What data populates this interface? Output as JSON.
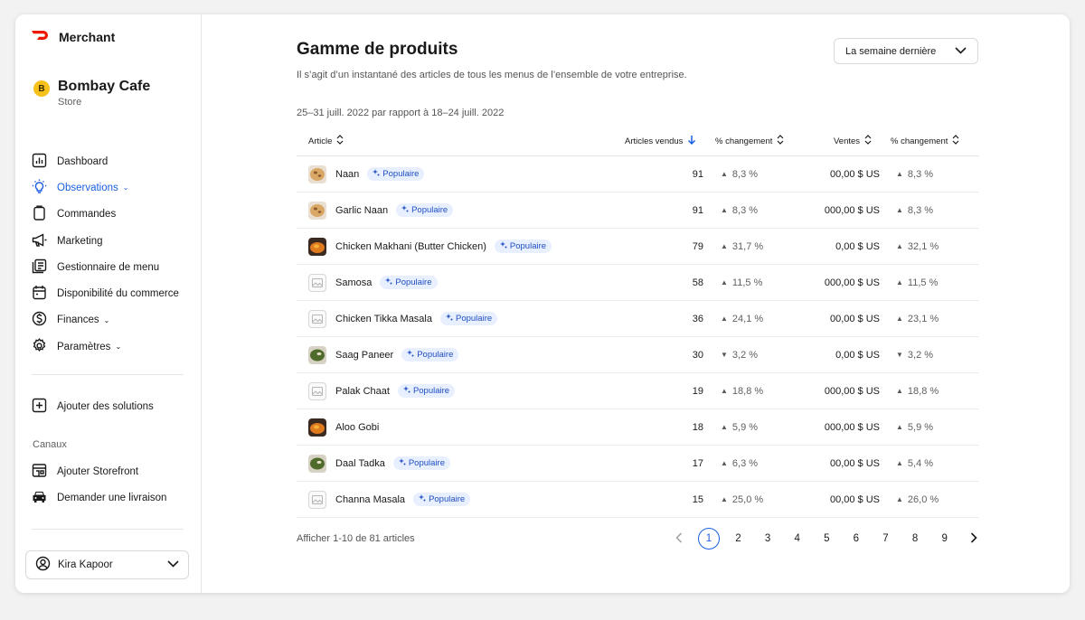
{
  "app": {
    "brand": "Merchant",
    "brand_color": "#eb1700",
    "accent": "#1a5fe0"
  },
  "store": {
    "initial": "B",
    "name": "Bombay Cafe",
    "type": "Store"
  },
  "sidebar": {
    "items": [
      {
        "label": "Dashboard",
        "icon": "chart-icon"
      },
      {
        "label": "Observations",
        "icon": "lightbulb-icon",
        "active": true,
        "caret": "⌄"
      },
      {
        "label": "Commandes",
        "icon": "clipboard-icon"
      },
      {
        "label": "Marketing",
        "icon": "megaphone-icon"
      },
      {
        "label": "Gestionnaire de menu",
        "icon": "menu-book-icon"
      },
      {
        "label": "Disponibilité du commerce",
        "icon": "calendar-icon"
      },
      {
        "label": "Finances",
        "icon": "dollar-icon",
        "caret": "⌄"
      },
      {
        "label": "Paramètres",
        "icon": "gear-icon",
        "caret": "⌄"
      }
    ],
    "add_solutions": "Ajouter des solutions",
    "channels_label": "Canaux",
    "channels": [
      {
        "label": "Ajouter Storefront",
        "icon": "storefront-icon"
      },
      {
        "label": "Demander une livraison",
        "icon": "car-icon"
      }
    ],
    "user": "Kira Kapoor"
  },
  "main": {
    "title": "Gamme de produits",
    "subtitle": "Il s’agit d’un instantané des articles de tous les menus de l’ensemble de votre entreprise.",
    "period": "La semaine dernière",
    "date_range": "25–31 juill. 2022 par rapport à 18–24 juill. 2022",
    "columns": {
      "article": "Article",
      "sold": "Articles vendus",
      "change1": "% changement",
      "sales": "Ventes",
      "change2": "% changement"
    },
    "badge_label": "Populaire",
    "rows": [
      {
        "name": "Naan",
        "popular": true,
        "thumb": "bread",
        "sold": "91",
        "change1": "8,3 %",
        "dir1": "up",
        "sales": "00,00 $ US",
        "change2": "8,3 %",
        "dir2": "up"
      },
      {
        "name": "Garlic Naan",
        "popular": true,
        "thumb": "bread",
        "sold": "91",
        "change1": "8,3 %",
        "dir1": "up",
        "sales": "000,00 $ US",
        "change2": "8,3 %",
        "dir2": "up"
      },
      {
        "name": "Chicken Makhani (Butter Chicken)",
        "popular": true,
        "thumb": "curry",
        "sold": "79",
        "change1": "31,7 %",
        "dir1": "up",
        "sales": "0,00 $ US",
        "change2": "32,1 %",
        "dir2": "up"
      },
      {
        "name": "Samosa",
        "popular": true,
        "thumb": "placeholder",
        "sold": "58",
        "change1": "11,5 %",
        "dir1": "up",
        "sales": "000,00 $ US",
        "change2": "11,5 %",
        "dir2": "up"
      },
      {
        "name": "Chicken Tikka Masala",
        "popular": true,
        "thumb": "placeholder",
        "sold": "36",
        "change1": "24,1 %",
        "dir1": "up",
        "sales": "00,00 $ US",
        "change2": "23,1 %",
        "dir2": "up"
      },
      {
        "name": "Saag Paneer",
        "popular": true,
        "thumb": "greens",
        "sold": "30",
        "change1": "3,2 %",
        "dir1": "down",
        "sales": "0,00 $ US",
        "change2": "3,2 %",
        "dir2": "down"
      },
      {
        "name": "Palak Chaat",
        "popular": true,
        "thumb": "placeholder",
        "sold": "19",
        "change1": "18,8 %",
        "dir1": "up",
        "sales": "000,00 $ US",
        "change2": "18,8 %",
        "dir2": "up"
      },
      {
        "name": "Aloo Gobi",
        "popular": false,
        "thumb": "curry",
        "sold": "18",
        "change1": "5,9 %",
        "dir1": "up",
        "sales": "000,00 $ US",
        "change2": "5,9 %",
        "dir2": "up"
      },
      {
        "name": "Daal Tadka",
        "popular": true,
        "thumb": "greens",
        "sold": "17",
        "change1": "6,3 %",
        "dir1": "up",
        "sales": "00,00 $ US",
        "change2": "5,4 %",
        "dir2": "up"
      },
      {
        "name": "Channa Masala",
        "popular": true,
        "thumb": "placeholder",
        "sold": "15",
        "change1": "25,0 %",
        "dir1": "up",
        "sales": "00,00 $ US",
        "change2": "26,0 %",
        "dir2": "up"
      }
    ],
    "footer_count": "Afficher 1-10 de 81 articles",
    "pagination": {
      "current": "1",
      "pages": [
        "1",
        "2",
        "3",
        "4",
        "5",
        "6",
        "7",
        "8",
        "9"
      ]
    }
  }
}
